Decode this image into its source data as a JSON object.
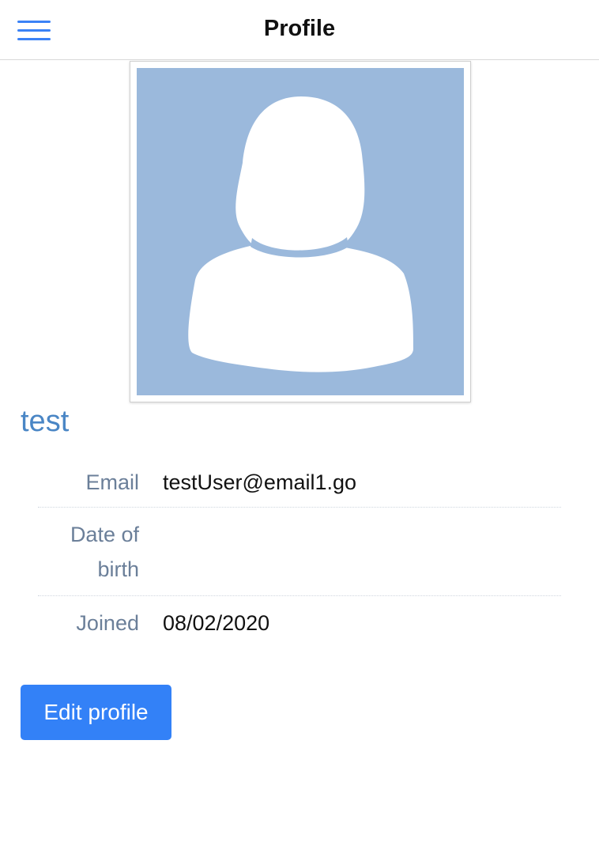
{
  "header": {
    "title": "Profile",
    "menu_icon": "hamburger-menu-icon"
  },
  "profile": {
    "avatar_icon": "default-user-avatar-icon",
    "name": "test",
    "fields": [
      {
        "label": "Email",
        "value": "testUser@email1.go"
      },
      {
        "label": "Date of birth",
        "value": ""
      },
      {
        "label": "Joined",
        "value": "08/02/2020"
      }
    ]
  },
  "actions": {
    "edit_label": "Edit profile"
  },
  "colors": {
    "accent": "#3381f7",
    "avatar_bg": "#9bb9dc",
    "name_color": "#4a86c5",
    "label_color": "#6b7f99"
  }
}
